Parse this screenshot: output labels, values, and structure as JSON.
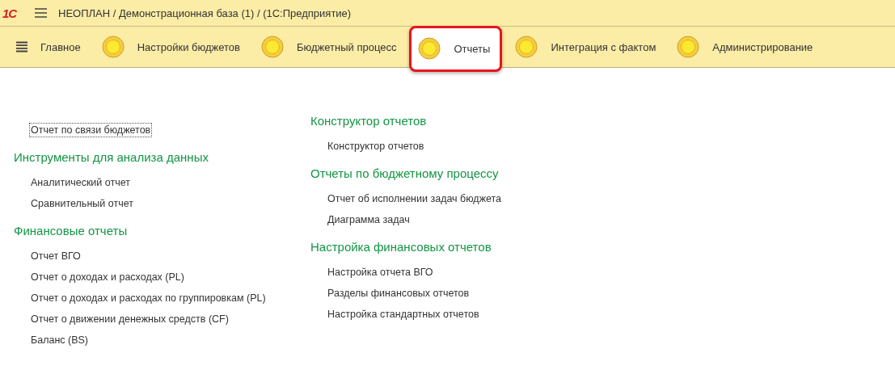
{
  "title_bar": {
    "logo": "1С",
    "title": "НЕОПЛАН / Демонстрационная база (1) /  (1С:Предприятие)"
  },
  "sections": [
    {
      "label": "Главное",
      "kind": "menu",
      "selected": false
    },
    {
      "label": "Настройки бюджетов",
      "kind": "section",
      "selected": false
    },
    {
      "label": "Бюджетный процесс",
      "kind": "section",
      "selected": false
    },
    {
      "label": "Отчеты",
      "kind": "section",
      "selected": true
    },
    {
      "label": "Интеграция с фактом",
      "kind": "section",
      "selected": false
    },
    {
      "label": "Администрирование",
      "kind": "section",
      "selected": false
    }
  ],
  "columns": [
    {
      "groups": [
        {
          "items": [
            {
              "label": "Отчет по связи бюджетов",
              "focused": true
            }
          ]
        },
        {
          "heading": "Инструменты для анализа данных",
          "items": [
            {
              "label": "Аналитический отчет",
              "focused": false
            },
            {
              "label": "Сравнительный отчет",
              "focused": false
            }
          ]
        },
        {
          "heading": "Финансовые отчеты",
          "items": [
            {
              "label": "Отчет ВГО",
              "focused": false
            },
            {
              "label": "Отчет о доходах и расходах (PL)",
              "focused": false
            },
            {
              "label": "Отчет о доходах и расходах по группировкам (PL)",
              "focused": false
            },
            {
              "label": "Отчет о движении денежных средств (CF)",
              "focused": false
            },
            {
              "label": "Баланс (BS)",
              "focused": false
            }
          ]
        }
      ]
    },
    {
      "groups": [
        {
          "heading": "Конструктор отчетов",
          "items": [
            {
              "label": "Конструктор отчетов",
              "focused": false
            }
          ]
        },
        {
          "heading": "Отчеты по бюджетному процессу",
          "items": [
            {
              "label": "Отчет об исполнении задач бюджета",
              "focused": false
            },
            {
              "label": "Диаграмма задач",
              "focused": false
            }
          ]
        },
        {
          "heading": "Настройка финансовых отчетов",
          "items": [
            {
              "label": "Настройка отчета ВГО",
              "focused": false
            },
            {
              "label": "Разделы финансовых отчетов",
              "focused": false
            },
            {
              "label": "Настройка стандартных отчетов",
              "focused": false
            }
          ]
        }
      ]
    }
  ]
}
